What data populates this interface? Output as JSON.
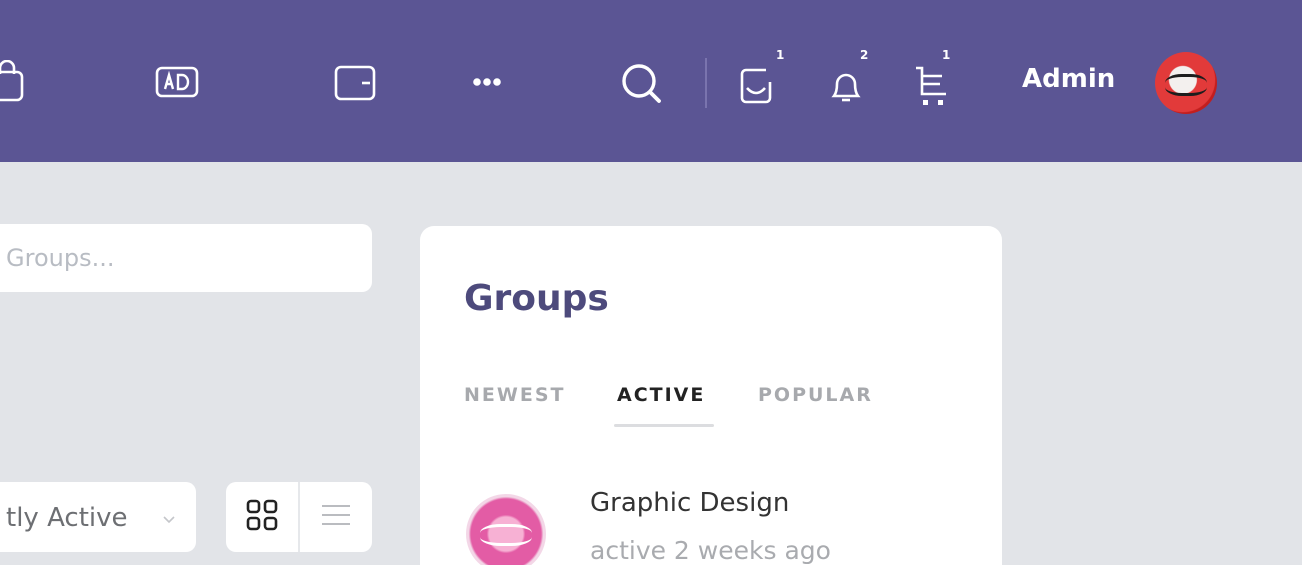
{
  "header": {
    "badges": {
      "messages": "1",
      "notifications": "2",
      "cart": "1"
    },
    "user": {
      "name": "Admin"
    }
  },
  "search": {
    "placeholder": "Groups..."
  },
  "filter": {
    "selected": "tly Active"
  },
  "groups_widget": {
    "title": "Groups",
    "tabs": [
      {
        "label": "NEWEST"
      },
      {
        "label": "ACTIVE"
      },
      {
        "label": "POPULAR"
      }
    ],
    "items": [
      {
        "name": "Graphic Design",
        "meta": "active 2 weeks ago"
      }
    ]
  },
  "colors": {
    "topbar": "#5b5594",
    "background": "#e2e4e8",
    "accent_title": "#4d4a7c"
  },
  "icons": [
    "shopping-bag-icon",
    "ad-icon",
    "wallet-icon",
    "more-icon",
    "search-icon",
    "messages-icon",
    "bell-icon",
    "cart-icon",
    "chevron-down-icon",
    "grid-view-icon",
    "list-view-icon"
  ]
}
